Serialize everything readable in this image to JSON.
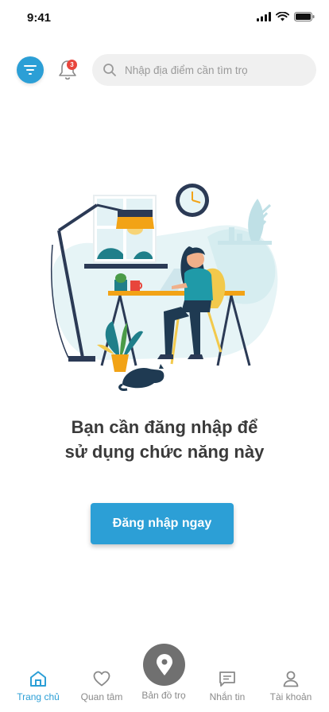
{
  "status_bar": {
    "time": "9:41"
  },
  "header": {
    "notification_count": "3",
    "search_placeholder": "Nhập địa điểm cần tìm trọ"
  },
  "main": {
    "message_line1": "Bạn cần đăng nhập để",
    "message_line2": "sử dụng chức năng này",
    "login_button": "Đăng nhập ngay"
  },
  "bottom_nav": {
    "home": "Trang chủ",
    "favorites": "Quan tâm",
    "map": "Bản đồ trọ",
    "messages": "Nhắn tin",
    "account": "Tài khoản"
  },
  "colors": {
    "accent": "#2c9fd6",
    "badge": "#e8453c",
    "map_button": "#707070"
  }
}
